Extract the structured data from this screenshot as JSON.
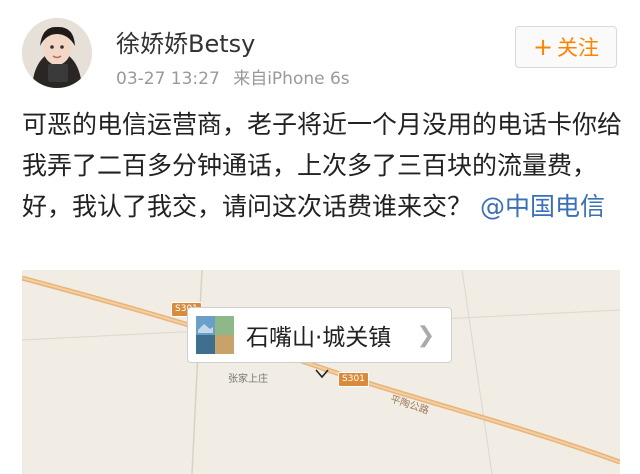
{
  "post": {
    "author": "徐娇娇Betsy",
    "time": "03-27 13:27",
    "source": "来自iPhone 6s",
    "follow_label": "关注",
    "text": "可恶的电信运营商，老子将近一个月没用的电话卡你给我弄了二百多分钟通话，上次多了三百块的流量费，好，我认了我交，请问这次话费谁来交？",
    "mention": "@中国电信"
  },
  "map": {
    "place_name": "石嘴山·城关镇",
    "road_badge_1": "S301",
    "road_badge_2": "S301",
    "village_label": "张家上庄",
    "road_label": "平陶公路"
  },
  "icons": {
    "follow": "plus-icon",
    "place": "chevron-right-icon",
    "marker": "map-marker-icon"
  },
  "colors": {
    "follow": "#ff8200",
    "mention": "#3b6fb6",
    "road": "#e2a35c",
    "map_bg": "#f1ede4"
  }
}
